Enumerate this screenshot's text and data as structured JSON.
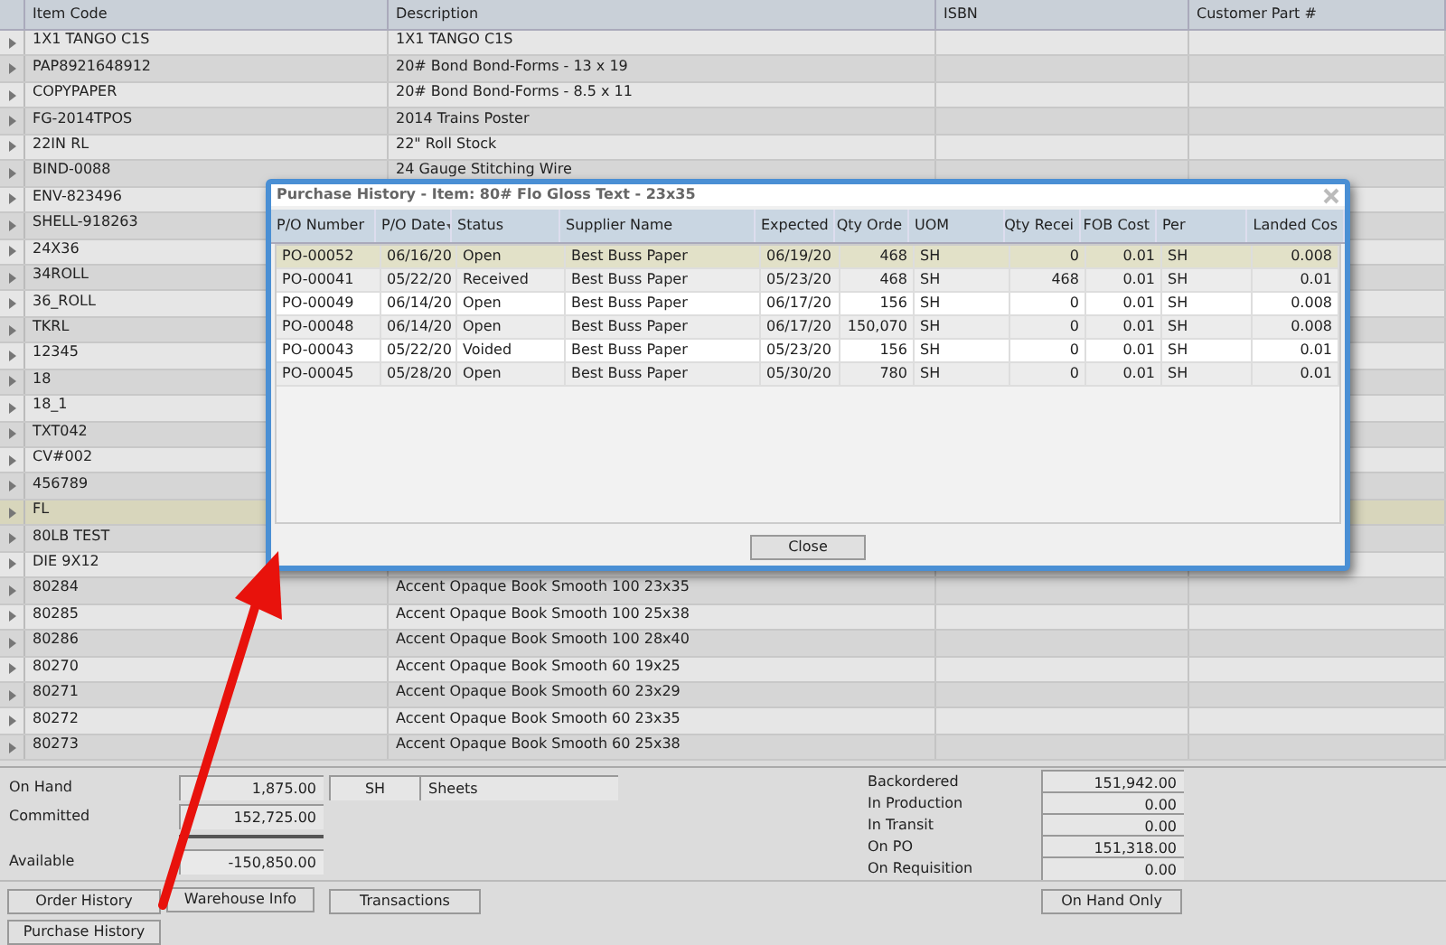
{
  "grid": {
    "columns": [
      "Item Code",
      "Description",
      "ISBN",
      "Customer Part #"
    ],
    "rows": [
      {
        "code": "1X1 TANGO C1S",
        "description": "1X1 TANGO C1S",
        "selected": false
      },
      {
        "code": "PAP8921648912",
        "description": "20#  Bond Bond-Forms - 13 x 19",
        "selected": false
      },
      {
        "code": "COPYPAPER",
        "description": "20#  Bond Bond-Forms - 8.5 x 11",
        "selected": false
      },
      {
        "code": "FG-2014TPOS",
        "description": "2014 Trains Poster",
        "selected": false
      },
      {
        "code": "22IN RL",
        "description": "22\" Roll Stock",
        "selected": false
      },
      {
        "code": "BIND-0088",
        "description": "24 Gauge Stitching Wire",
        "selected": false
      },
      {
        "code": "ENV-823496",
        "selected": false
      },
      {
        "code": "SHELL-918263",
        "selected": false
      },
      {
        "code": "24X36",
        "selected": false
      },
      {
        "code": "34ROLL",
        "selected": false
      },
      {
        "code": "36_ROLL",
        "selected": false
      },
      {
        "code": "TKRL",
        "selected": false
      },
      {
        "code": "12345",
        "selected": false
      },
      {
        "code": "18",
        "selected": false
      },
      {
        "code": "18_1",
        "selected": false
      },
      {
        "code": "TXT042",
        "selected": false
      },
      {
        "code": "CV#002",
        "selected": false
      },
      {
        "code": "456789",
        "selected": false
      },
      {
        "code": "FL",
        "selected": true
      },
      {
        "code": "80LB TEST",
        "selected": false
      },
      {
        "code": "DIE 9X12",
        "selected": false
      },
      {
        "code": "80284",
        "description": "Accent Opaque Book Smooth 100 23x35",
        "selected": false
      },
      {
        "code": "80285",
        "description": "Accent Opaque Book Smooth 100 25x38",
        "selected": false
      },
      {
        "code": "80286",
        "description": "Accent Opaque Book Smooth 100 28x40",
        "selected": false
      },
      {
        "code": "80270",
        "description": "Accent Opaque Book Smooth 60 19x25",
        "selected": false
      },
      {
        "code": "80271",
        "description": "Accent Opaque Book Smooth 60 23x29",
        "selected": false
      },
      {
        "code": "80272",
        "description": "Accent Opaque Book Smooth 60 23x35",
        "selected": false
      },
      {
        "code": "80273",
        "description": "Accent Opaque Book Smooth 60 25x38",
        "selected": false
      }
    ]
  },
  "stock": {
    "on_hand": {
      "label": "On Hand",
      "value": "1,875.00",
      "uom": "SH",
      "uom_name": "Sheets"
    },
    "committed": {
      "label": "Committed",
      "value": "152,725.00"
    },
    "available": {
      "label": "Available",
      "value": "-150,850.00"
    },
    "totals": [
      {
        "label": "Backordered",
        "value": "151,942.00"
      },
      {
        "label": "In Production",
        "value": "0.00"
      },
      {
        "label": "In Transit",
        "value": "0.00"
      },
      {
        "label": "On PO",
        "value": "151,318.00"
      },
      {
        "label": "On Requisition",
        "value": "0.00"
      }
    ]
  },
  "buttons": [
    "Order History",
    "Warehouse Info",
    "Transactions",
    "On Hand Only",
    "Purchase History"
  ],
  "dialog": {
    "title": "Purchase History - Item: 80# Flo Gloss Text - 23x35",
    "columns": [
      "P/O Number",
      "P/O Date",
      "Status",
      "Supplier Name",
      "Expected",
      "Qty Orde",
      "UOM",
      "Qty Recei",
      "FOB Cost",
      "Per",
      "Landed Cos"
    ],
    "rows": [
      {
        "cells": [
          "PO-00052",
          "06/16/20",
          "Open",
          "Best Buss Paper",
          "06/19/20",
          "468",
          "SH",
          "0",
          "0.01",
          "SH",
          "0.008"
        ],
        "selected": true
      },
      {
        "cells": [
          "PO-00041",
          "05/22/20",
          "Received",
          "Best Buss Paper",
          "05/23/20",
          "468",
          "SH",
          "468",
          "0.01",
          "SH",
          "0.01"
        ],
        "selected": false
      },
      {
        "cells": [
          "PO-00049",
          "06/14/20",
          "Open",
          "Best Buss Paper",
          "06/17/20",
          "156",
          "SH",
          "0",
          "0.01",
          "SH",
          "0.008"
        ],
        "selected": false
      },
      {
        "cells": [
          "PO-00048",
          "06/14/20",
          "Open",
          "Best Buss Paper",
          "06/17/20",
          "150,070",
          "SH",
          "0",
          "0.01",
          "SH",
          "0.008"
        ],
        "selected": false
      },
      {
        "cells": [
          "PO-00043",
          "05/22/20",
          "Voided",
          "Best Buss Paper",
          "05/23/20",
          "156",
          "SH",
          "0",
          "0.01",
          "SH",
          "0.01"
        ],
        "selected": false
      },
      {
        "cells": [
          "PO-00045",
          "05/28/20",
          "Open",
          "Best Buss Paper",
          "05/30/20",
          "780",
          "SH",
          "0",
          "0.01",
          "SH",
          "0.01"
        ],
        "selected": false
      }
    ],
    "close_button": "Close"
  }
}
